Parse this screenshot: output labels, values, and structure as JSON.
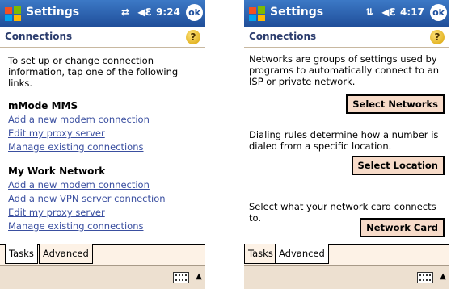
{
  "left": {
    "app_title": "Settings",
    "clock": "9:24",
    "ok": "ok",
    "page_title": "Connections",
    "intro": "To set up or change connection information, tap one of the following links.",
    "sections": [
      {
        "title": "mMode MMS",
        "links": [
          "Add a new modem connection",
          "Edit my proxy server",
          "Manage existing connections"
        ]
      },
      {
        "title": "My Work Network",
        "links": [
          "Add a new modem connection",
          "Add a new VPN server connection",
          "Edit my proxy server",
          "Manage existing connections"
        ]
      }
    ],
    "tabs": [
      "Tasks",
      "Advanced"
    ],
    "active_tab": "Tasks"
  },
  "right": {
    "app_title": "Settings",
    "clock": "4:17",
    "ok": "ok",
    "page_title": "Connections",
    "networks_text": "Networks are groups of settings used by programs to automatically connect to an ISP or private network.",
    "select_networks": "Select Networks",
    "dialing_text": "Dialing rules determine how a number is dialed from a specific location.",
    "select_location": "Select Location",
    "card_text": "Select what your network card connects to.",
    "network_card": "Network Card",
    "tabs": [
      "Tasks",
      "Advanced"
    ],
    "active_tab": "Advanced"
  },
  "icons": [
    "windows-start-icon",
    "connectivity-icon",
    "volume-icon",
    "ok-icon",
    "help-icon",
    "keyboard-icon",
    "up-arrow-icon"
  ],
  "colors": {
    "titlebar": "#2a5fb0",
    "link": "#3a4fa0",
    "button_bg": "#f7dbc9",
    "page_title": "#2b3c6d"
  }
}
